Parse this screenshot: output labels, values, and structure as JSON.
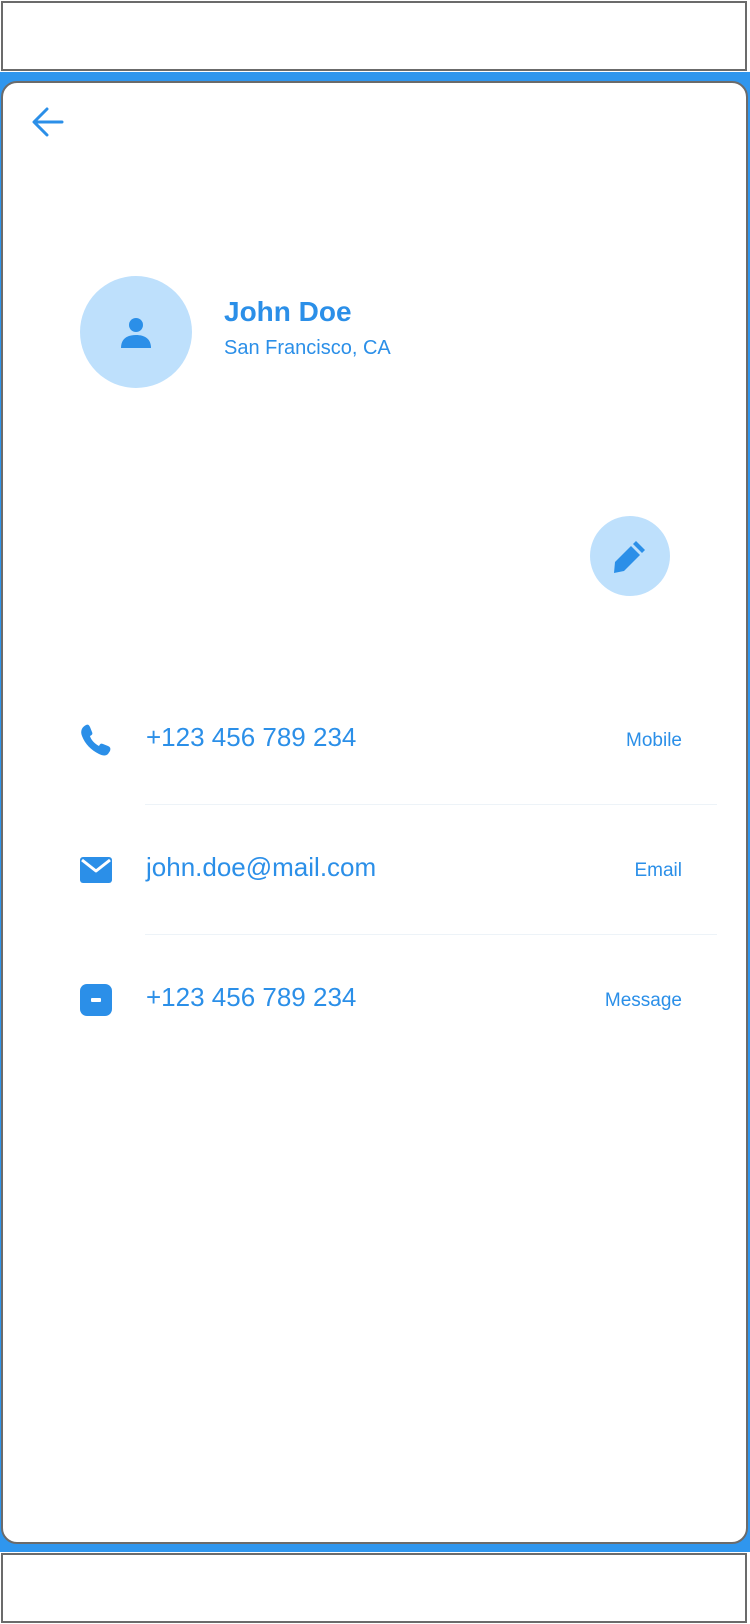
{
  "header": {
    "back_icon": "arrow-left-icon"
  },
  "profile": {
    "name": "John Doe",
    "location": "San Francisco, CA",
    "avatar_icon": "person-icon",
    "edit_icon": "pencil-icon"
  },
  "contacts": [
    {
      "icon": "phone-icon",
      "value": "+123 456 789 234",
      "type": "Mobile"
    },
    {
      "icon": "mail-icon",
      "value": "john.doe@mail.com",
      "type": "Email"
    },
    {
      "icon": "message-icon",
      "value": "+123 456 789 234",
      "type": "Message"
    }
  ],
  "colors": {
    "accent": "#2b8fe8",
    "frame": "#2f96ee",
    "light_accent": "#bee0fc",
    "border": "#6b6b6b"
  }
}
